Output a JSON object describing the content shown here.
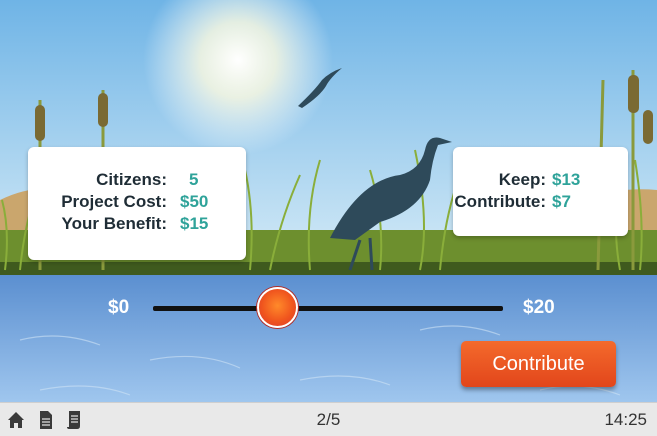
{
  "stats_card": {
    "citizens_label": "Citizens:",
    "citizens_value": "5",
    "project_cost_label": "Project Cost:",
    "project_cost_value": "$50",
    "your_benefit_label": "Your Benefit:",
    "your_benefit_value": "$15"
  },
  "allocation_card": {
    "keep_label": "Keep:",
    "keep_value": "$13",
    "contribute_label": "Contribute:",
    "contribute_value": "$7"
  },
  "slider": {
    "min_label": "$0",
    "max_label": "$20",
    "value": 7
  },
  "contribute_button_label": "Contribute",
  "bottom_bar": {
    "page_indicator": "2/5",
    "clock": "14:25",
    "icons": [
      "home-icon",
      "document-icon",
      "scroll-icon"
    ]
  },
  "colors": {
    "value_text": "#2fa39a",
    "button": "#e8501f",
    "slider_handle": "#f0561e"
  }
}
